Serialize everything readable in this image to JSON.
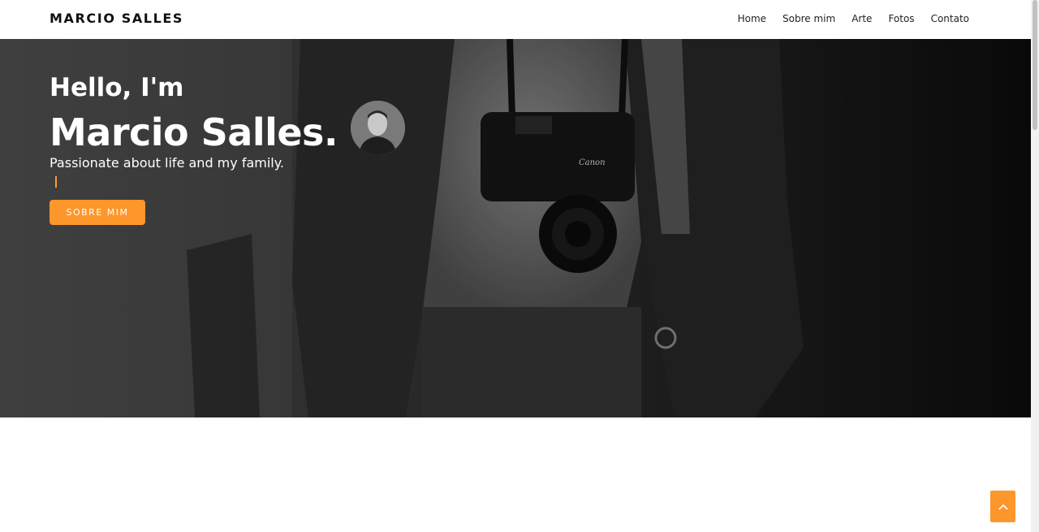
{
  "navbar": {
    "brand": "MARCIO SALLES",
    "links": [
      "Home",
      "Sobre mim",
      "Arte",
      "Fotos",
      "Contato"
    ]
  },
  "hero": {
    "greeting": "Hello, I'm",
    "name": "Marcio Salles.",
    "tagline": "Passionate about life and my family.",
    "cta_label": "SOBRE MIM",
    "camera_brand": "Canon"
  },
  "icons": {
    "back_to_top": "chevron-up-icon"
  },
  "colors": {
    "accent": "#fd962b",
    "nav_text": "#222222",
    "brand_text": "#111111"
  }
}
